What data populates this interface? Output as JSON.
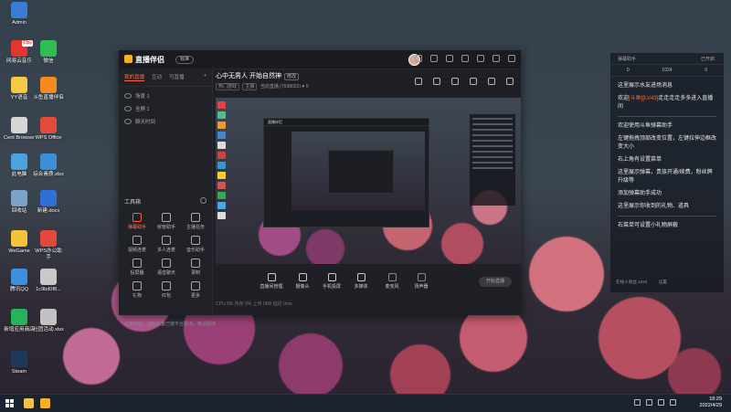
{
  "desktop_icons": [
    {
      "label": "Admin",
      "badge": ""
    },
    {
      "label": "网易云音乐",
      "badge": "扫码"
    },
    {
      "label": "微信",
      "badge": ""
    },
    {
      "label": "YY语音",
      "badge": ""
    },
    {
      "label": "斗鱼直播伴侣",
      "badge": ""
    },
    {
      "label": "Cent Browser",
      "badge": ""
    },
    {
      "label": "WPS Office",
      "badge": ""
    },
    {
      "label": "此电脑",
      "badge": ""
    },
    {
      "label": "综合素质.xlsx",
      "badge": ""
    },
    {
      "label": "回收站",
      "badge": ""
    },
    {
      "label": "新建.docx",
      "badge": ""
    },
    {
      "label": "WeGame",
      "badge": ""
    },
    {
      "label": "WPS办公助手",
      "badge": ""
    },
    {
      "label": "腾讯QQ",
      "badge": ""
    },
    {
      "label": "1c9bd0f8...",
      "badge": ""
    },
    {
      "label": "新增应用商店",
      "badge": ""
    },
    {
      "label": "社团活动.xlsx",
      "badge": ""
    },
    {
      "label": "Steam",
      "badge": ""
    }
  ],
  "app": {
    "brand": "直播伴侣",
    "version": "标准",
    "sidebar_tabs": [
      "我的直播",
      "互动",
      "可直播"
    ],
    "scenes": [
      "场景 1",
      "全屏 1",
      "聊天时间"
    ],
    "tools_title": "工具箱",
    "tools": [
      {
        "label": "弹幕助手",
        "active": true
      },
      {
        "label": "房管助手",
        "active": false
      },
      {
        "label": "主播任务",
        "active": false
      },
      {
        "label": "视频连麦",
        "active": false
      },
      {
        "label": "多人连麦",
        "active": false
      },
      {
        "label": "音乐助手",
        "active": false
      },
      {
        "label": "投屏器",
        "active": false
      },
      {
        "label": "语音聊天",
        "active": false
      },
      {
        "label": "录制",
        "active": false
      },
      {
        "label": "礼物",
        "active": false
      },
      {
        "label": "红包",
        "active": false
      },
      {
        "label": "更多",
        "active": false
      }
    ],
    "sidebar_notice": "礼物特效、自助设置已按平台要求，敬请期待",
    "stream_title": "心中无男人 开始自然神",
    "stream_tag": "修改",
    "stream_sub": [
      "热门游戏",
      "主播",
      "当前直播"
    ],
    "stream_id": "7698001",
    "viewer_count": "0",
    "controls": [
      {
        "label": "直播间管理",
        "red": false
      },
      {
        "label": "摄像头",
        "red": false
      },
      {
        "label": "手机投屏",
        "red": false
      },
      {
        "label": "多媒体",
        "red": false
      },
      {
        "label": "麦克风",
        "red": true
      },
      {
        "label": "扬声器",
        "red": true
      }
    ],
    "live_button": "开始直播",
    "footer": "CPU 0%   内存 0%   上传 0KB   延迟 0ms"
  },
  "chat": {
    "title": "弹幕助手",
    "status": "已开启",
    "stats": [
      "0",
      "1024",
      "0"
    ],
    "messages": [
      {
        "pre": "这里展示水友进场消息",
        "hl": "",
        "post": ""
      },
      {
        "pre": "欢迎",
        "hl": "[斗鱼][LV43]",
        "post": "走走走走多多进入直播间"
      },
      {
        "pre": "欢迎使用斗鱼弹幕助手",
        "hl": "",
        "post": ""
      },
      {
        "pre": "左键拖拽顶部改变位置，左键拉伸边框改变大小",
        "hl": "",
        "post": ""
      },
      {
        "pre": "右上角有设置菜单",
        "hl": "",
        "post": ""
      },
      {
        "pre": "这里展示弹幕，贵族开通/续费，粉丝牌升级等",
        "hl": "",
        "post": ""
      },
      {
        "pre": "添加弹幕助手成功",
        "hl": "",
        "post": ""
      },
      {
        "pre": "这里展示你收到的礼物、道具",
        "hl": "",
        "post": ""
      },
      {
        "pre": "右菜单可设置小礼物屏蔽",
        "hl": "",
        "post": ""
      }
    ],
    "bottom_left": "在线 0  粉丝 1024",
    "bottom_right": "设置"
  },
  "taskbar": {
    "time": "18:29",
    "date": "2022/4/29",
    "colors": {
      "accent": "#ff6a3d",
      "brand": "#f5b12a"
    }
  }
}
